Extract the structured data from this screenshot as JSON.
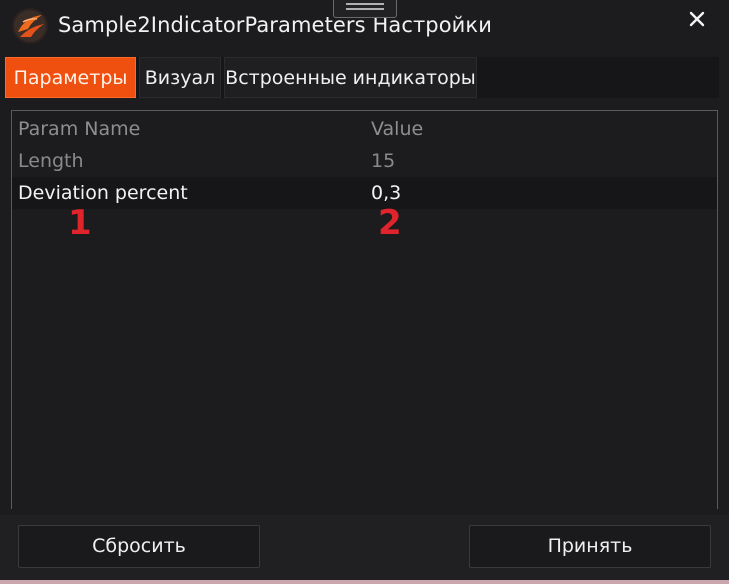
{
  "window": {
    "title": "Sample2IndicatorParameters  Настройки"
  },
  "icons": {
    "app": "app-logo-icon",
    "close": "close-icon",
    "grip": "drag-grip-icon"
  },
  "tabs": [
    {
      "label": "Параметры",
      "active": true
    },
    {
      "label": "Визуал",
      "active": false
    },
    {
      "label": "Встроенные индикаторы",
      "active": false
    }
  ],
  "grid": {
    "header": {
      "name": "Param Name",
      "value": "Value"
    },
    "rows": [
      {
        "name": "Length",
        "value": "15"
      },
      {
        "name": "Deviation percent",
        "value": "0,3"
      }
    ]
  },
  "markers": [
    "1",
    "2"
  ],
  "footer": {
    "reset_label": "Сбросить",
    "apply_label": "Принять"
  },
  "colors": {
    "accent": "#f0500f",
    "marker": "#e0242c",
    "background": "#1c1c1e"
  }
}
